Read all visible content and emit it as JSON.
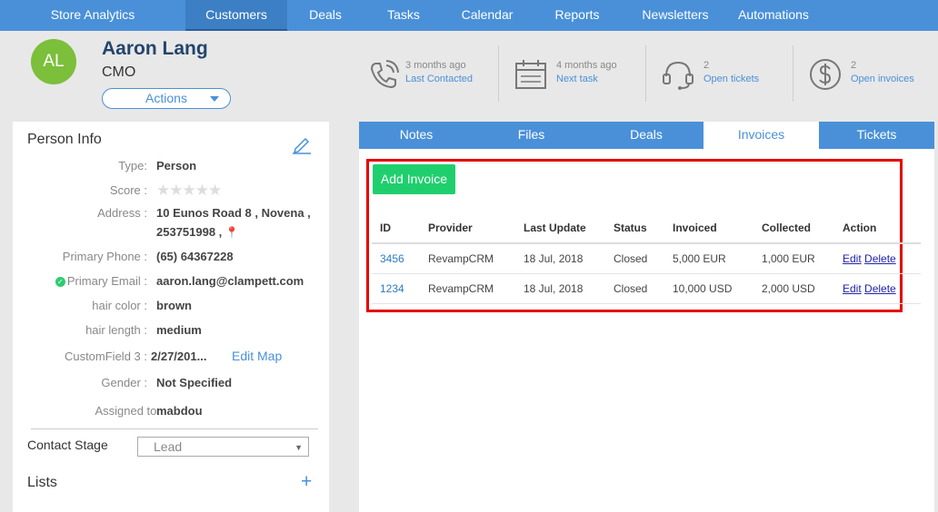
{
  "nav": {
    "items": [
      {
        "label": "Store Analytics",
        "active": false
      },
      {
        "label": "Customers",
        "active": true
      },
      {
        "label": "Deals",
        "active": false
      },
      {
        "label": "Tasks",
        "active": false
      },
      {
        "label": "Calendar",
        "active": false
      },
      {
        "label": "Reports",
        "active": false
      },
      {
        "label": "Newsletters",
        "active": false
      },
      {
        "label": "Automations",
        "active": false
      }
    ]
  },
  "person": {
    "initials": "AL",
    "name": "Aaron Lang",
    "title": "CMO",
    "actions_label": "Actions"
  },
  "summary": [
    {
      "icon": "phone-icon",
      "line1": "3 months ago",
      "line2": "Last Contacted"
    },
    {
      "icon": "calendar-icon",
      "line1": "4 months ago",
      "line2": "Next task"
    },
    {
      "icon": "headset-icon",
      "line1": "2",
      "line2": "Open tickets"
    },
    {
      "icon": "dollar-icon",
      "line1": "2",
      "line2": "Open invoices"
    }
  ],
  "person_info": {
    "title": "Person Info",
    "type_label": "Type:",
    "type_value": "Person",
    "score_label": "Score :",
    "score_value": 0,
    "score_max": 5,
    "address_label": "Address :",
    "address_line1": "10 Eunos Road 8 , Novena ,",
    "address_line2": "253751998 ,",
    "phone_label": "Primary Phone :",
    "phone_value": "(65) 64367228",
    "email_label": "Primary Email :",
    "email_value": "aaron.lang@clampett.com",
    "hair_color_label": "hair color :",
    "hair_color_value": "brown",
    "hair_length_label": "hair length :",
    "hair_length_value": "medium",
    "custom3_label": "CustomField 3 :",
    "custom3_value": "2/27/201...",
    "edit_map_label": "Edit Map",
    "gender_label": "Gender :",
    "gender_value": "Not Specified",
    "assigned_label": "Assigned to:",
    "assigned_value": "mabdou",
    "contact_stage_label": "Contact Stage",
    "contact_stage_value": "Lead",
    "lists_label": "Lists"
  },
  "tabs": [
    {
      "label": "Notes",
      "active": false
    },
    {
      "label": "Files",
      "active": false
    },
    {
      "label": "Deals",
      "active": false
    },
    {
      "label": "Invoices",
      "active": true
    },
    {
      "label": "Tickets",
      "active": false
    }
  ],
  "invoices": {
    "add_label": "Add Invoice",
    "columns": [
      "ID",
      "Provider",
      "Last Update",
      "Status",
      "Invoiced",
      "Collected",
      "Action"
    ],
    "rows": [
      {
        "id": "3456",
        "provider": "RevampCRM",
        "last_update": "18 Jul, 2018",
        "status": "Closed",
        "invoiced": "5,000 EUR",
        "collected": "1,000 EUR",
        "edit": "Edit",
        "delete": "Delete"
      },
      {
        "id": "1234",
        "provider": "RevampCRM",
        "last_update": "18 Jul, 2018",
        "status": "Closed",
        "invoiced": "10,000 USD",
        "collected": "2,000 USD",
        "edit": "Edit",
        "delete": "Delete"
      }
    ]
  },
  "colors": {
    "nav_bg": "#4a90d9",
    "accent": "#4a90d9",
    "avatar": "#7cbf3a",
    "add_button": "#1fcf6e",
    "highlight_box": "#e60000"
  }
}
